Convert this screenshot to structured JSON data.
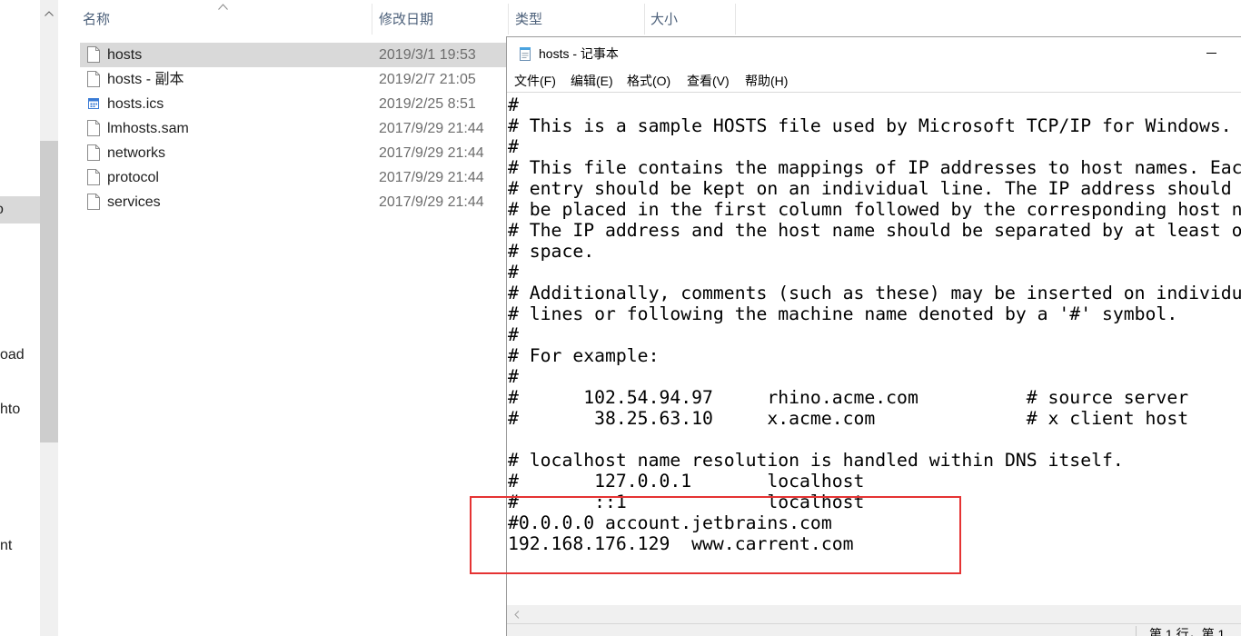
{
  "nav_pane": {
    "items": [
      {
        "label": "o",
        "selected": true
      },
      {
        "label": "oad",
        "selected": false
      },
      {
        "label": "hto",
        "selected": false
      },
      {
        "label": "nt",
        "selected": false
      }
    ],
    "scroll_up_icon": "chevron-up-icon"
  },
  "explorer": {
    "columns": {
      "name": "名称",
      "modified": "修改日期",
      "type": "类型",
      "size": "大小"
    },
    "sort_icon": "chevron-up-icon",
    "files": [
      {
        "name": "hosts",
        "modified": "2019/3/1 19:53",
        "icon": "file-icon",
        "selected": true
      },
      {
        "name": "hosts - 副本",
        "modified": "2019/2/7 21:05",
        "icon": "file-icon",
        "selected": false
      },
      {
        "name": "hosts.ics",
        "modified": "2019/2/25 8:51",
        "icon": "calendar-file-icon",
        "selected": false
      },
      {
        "name": "lmhosts.sam",
        "modified": "2017/9/29 21:44",
        "icon": "file-icon",
        "selected": false
      },
      {
        "name": "networks",
        "modified": "2017/9/29 21:44",
        "icon": "file-icon",
        "selected": false
      },
      {
        "name": "protocol",
        "modified": "2017/9/29 21:44",
        "icon": "file-icon",
        "selected": false
      },
      {
        "name": "services",
        "modified": "2017/9/29 21:44",
        "icon": "file-icon",
        "selected": false
      }
    ]
  },
  "notepad": {
    "title": "hosts - 记事本",
    "icon": "notepad-icon",
    "minimize_icon": "minimize-icon",
    "menu": [
      "文件(F)",
      "编辑(E)",
      "格式(O)",
      "查看(V)",
      "帮助(H)"
    ],
    "lines": [
      "#",
      "# This is a sample HOSTS file used by Microsoft TCP/IP for Windows.",
      "#",
      "# This file contains the mappings of IP addresses to host names. Eac",
      "# entry should be kept on an individual line. The IP address should",
      "# be placed in the first column followed by the corresponding host n",
      "# The IP address and the host name should be separated by at least o",
      "# space.",
      "#",
      "# Additionally, comments (such as these) may be inserted on individu",
      "# lines or following the machine name denoted by a '#' symbol.",
      "#",
      "# For example:",
      "#",
      "#      102.54.94.97     rhino.acme.com          # source server",
      "#       38.25.63.10     x.acme.com              # x client host",
      "",
      "# localhost name resolution is handled within DNS itself.",
      "#       127.0.0.1       localhost",
      "#       ::1             localhost",
      "#0.0.0.0 account.jetbrains.com",
      "192.168.176.129  www.carrent.com"
    ],
    "scroll_left_icon": "chevron-left-icon",
    "status": "第 1 行，第 1"
  },
  "colors": {
    "selection_gray": "#d9d9d9",
    "annotation_red": "#e53333",
    "header_text": "#4c607a",
    "date_text": "#6d6d6d",
    "calendar_icon_blue": "#3a7bd5"
  }
}
